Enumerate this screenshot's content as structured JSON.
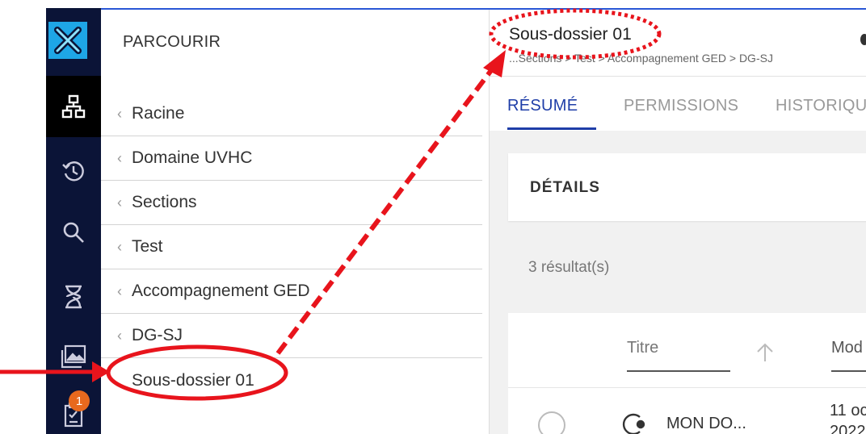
{
  "rail": {
    "icons": [
      "logo-x-icon",
      "hierarchy-icon",
      "history-icon",
      "search-icon",
      "hourglass-icon",
      "gallery-icon",
      "tasks-icon"
    ],
    "badge_count": "1",
    "colors": {
      "rail": "#0b1437",
      "logo": "#1ea6e6",
      "badge": "#e8691e"
    }
  },
  "browse": {
    "title": "PARCOURIR",
    "items": [
      {
        "label": "Racine"
      },
      {
        "label": "Domaine UVHC"
      },
      {
        "label": "Sections"
      },
      {
        "label": "Test"
      },
      {
        "label": "Accompagnement GED"
      },
      {
        "label": "DG-SJ"
      }
    ],
    "current": "Sous-dossier 01"
  },
  "document": {
    "title": "Sous-dossier 01",
    "breadcrumb": "...Sections > Test > Accompagnement GED > DG-SJ",
    "tabs": [
      {
        "label": "RÉSUMÉ",
        "active": true
      },
      {
        "label": "PERMISSIONS",
        "active": false
      },
      {
        "label": "HISTORIQU",
        "active": false
      }
    ],
    "details_title": "DÉTAILS",
    "results": "3 résultat(s)",
    "table": {
      "columns": [
        "Titre",
        "Mod"
      ],
      "rows": [
        {
          "title": "MON DO...",
          "date_line1": "11 oc",
          "date_line2": "2022"
        }
      ]
    }
  },
  "annotation_color": "#e8141c"
}
